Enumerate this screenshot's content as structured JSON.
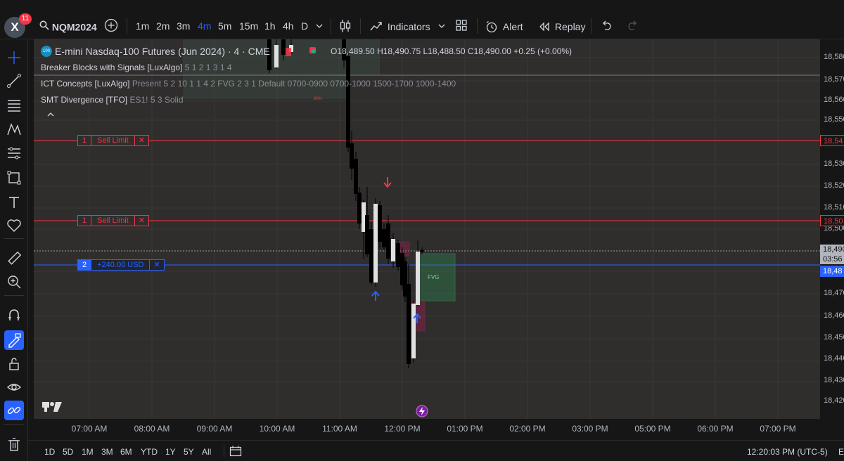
{
  "header": {
    "avatar_letter": "X",
    "notification_count": "11",
    "symbol": "NQM2024",
    "timeframes": [
      "1m",
      "2m",
      "3m",
      "4m",
      "5m",
      "15m",
      "1h",
      "4h",
      "D"
    ],
    "active_timeframe": "4m",
    "indicators_label": "Indicators",
    "alert_label": "Alert",
    "replay_label": "Replay"
  },
  "legend": {
    "symbol_badge": "100",
    "title": "E-mini Nasdaq-100 Futures (Jun 2024) · 4 · CME",
    "ohlc": {
      "open_label": "O",
      "open": "18,489.50",
      "high_label": "H",
      "high": "18,490.75",
      "low_label": "L",
      "low": "18,488.50",
      "close_label": "C",
      "close": "18,490.00",
      "change": "+0.25 (+0.00%)"
    },
    "indicators": [
      {
        "name": "Breaker Blocks with Signals [LuxAlgo]",
        "params": "5 1 2 1 3 1 4"
      },
      {
        "name": "ICT Concepts [LuxAlgo]",
        "params": "Present 5 2 10 1 1 4 2 FVG 2 3 1 Default 0700-0900 0700-1000 1500-1700 1000-1400"
      },
      {
        "name": "SMT Divergence [TFO]",
        "params": "ES1! 5 3 Solid"
      }
    ]
  },
  "orders": [
    {
      "qty": "1",
      "label": "Sell Limit",
      "close": "✕"
    },
    {
      "qty": "1",
      "label": "Sell Limit",
      "close": "✕"
    },
    {
      "qty": "2",
      "label": "+240.00 USD",
      "close": "✕"
    }
  ],
  "chart_annotations": {
    "fvg_label": "FVG",
    "pct_label": "80%"
  },
  "price_axis": {
    "ticks": [
      "18,580",
      "18,570",
      "18,560",
      "18,550",
      "18,530",
      "18,520",
      "18,510",
      "18,500",
      "18,470",
      "18,460",
      "18,450",
      "18,440",
      "18,430",
      "18,420"
    ],
    "sell_limit_1_price": "18,54",
    "sell_limit_2_price": "18,50",
    "last_price": "18,490",
    "countdown": "03:56",
    "position_price": "18,48"
  },
  "time_axis": {
    "ticks": [
      "07:00 AM",
      "08:00 AM",
      "09:00 AM",
      "10:00 AM",
      "11:00 AM",
      "12:00 PM",
      "01:00 PM",
      "02:00 PM",
      "03:00 PM",
      "05:00 PM",
      "06:00 PM",
      "07:00 PM"
    ]
  },
  "bottom_bar": {
    "ranges": [
      "1D",
      "5D",
      "1M",
      "3M",
      "6M",
      "YTD",
      "1Y",
      "5Y",
      "All"
    ],
    "clock": "12:20:03 PM (UTC-5)",
    "trailing": "E"
  },
  "colors": {
    "chart_bg": "#302d2d",
    "sell_red": "#f23645",
    "position_blue": "#2962ff",
    "fvg_green": "#2e7d4f",
    "breaker_red": "#c2185b"
  }
}
